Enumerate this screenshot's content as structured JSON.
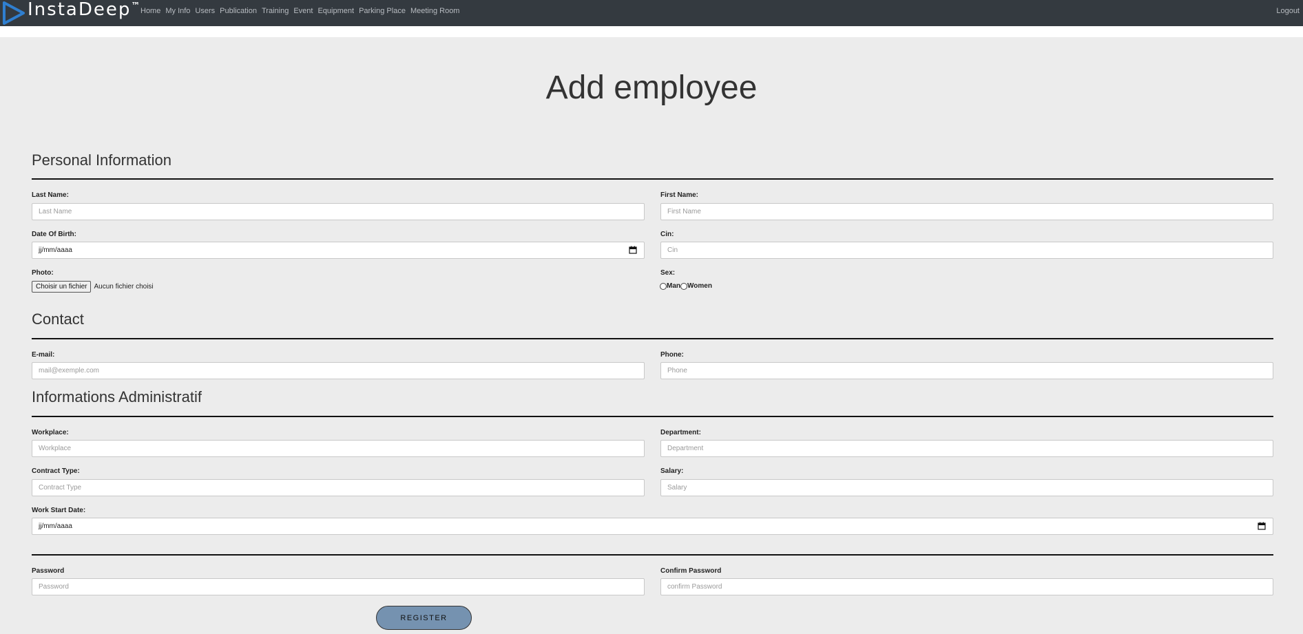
{
  "brand": {
    "name": "InstaDeep",
    "mark": "™"
  },
  "nav": {
    "links": [
      "Home",
      "My Info",
      "Users",
      "Publication",
      "Training",
      "Event",
      "Equipment",
      "Parking Place",
      "Meeting Room"
    ],
    "logout": "Logout"
  },
  "page": {
    "title": "Add employee"
  },
  "sections": {
    "personal": "Personal Information",
    "contact": "Contact",
    "admin": "Informations Administratif"
  },
  "fields": {
    "last_name": {
      "label": "Last Name:",
      "placeholder": "Last Name",
      "value": ""
    },
    "first_name": {
      "label": "First Name:",
      "placeholder": "First Name",
      "value": ""
    },
    "dob": {
      "label": "Date Of Birth:",
      "value": "jj/mm/aaaa"
    },
    "cin": {
      "label": "Cin:",
      "placeholder": "Cin",
      "value": ""
    },
    "photo": {
      "label": "Photo:",
      "button": "Choisir un fichier",
      "status": "Aucun fichier choisi"
    },
    "sex": {
      "label": "Sex:",
      "options": [
        "Man",
        "Women"
      ],
      "selected": null
    },
    "email": {
      "label": "E-mail:",
      "placeholder": "mail@exemple.com",
      "value": ""
    },
    "phone": {
      "label": "Phone:",
      "placeholder": "Phone",
      "value": ""
    },
    "workplace": {
      "label": "Workplace:",
      "placeholder": "Workplace",
      "value": ""
    },
    "department": {
      "label": "Department:",
      "placeholder": "Department",
      "value": ""
    },
    "contract_type": {
      "label": "Contract Type:",
      "placeholder": "Contract Type",
      "value": ""
    },
    "salary": {
      "label": "Salary:",
      "placeholder": "Salary",
      "value": ""
    },
    "work_start": {
      "label": "Work Start Date:",
      "value": "jj/mm/aaaa"
    },
    "password": {
      "label": "Password",
      "placeholder": "Password",
      "value": ""
    },
    "confirm_password": {
      "label": "Confirm Password",
      "placeholder": "confirm Password",
      "value": ""
    }
  },
  "actions": {
    "register": "REGISTER"
  },
  "colors": {
    "navbar": "#343a40",
    "page_bg": "#ececec",
    "register_button": "#7592b0",
    "brand_mark": "#2f7fd0"
  },
  "icons": {
    "brand": "play-triangle-icon",
    "date": "calendar-icon"
  }
}
